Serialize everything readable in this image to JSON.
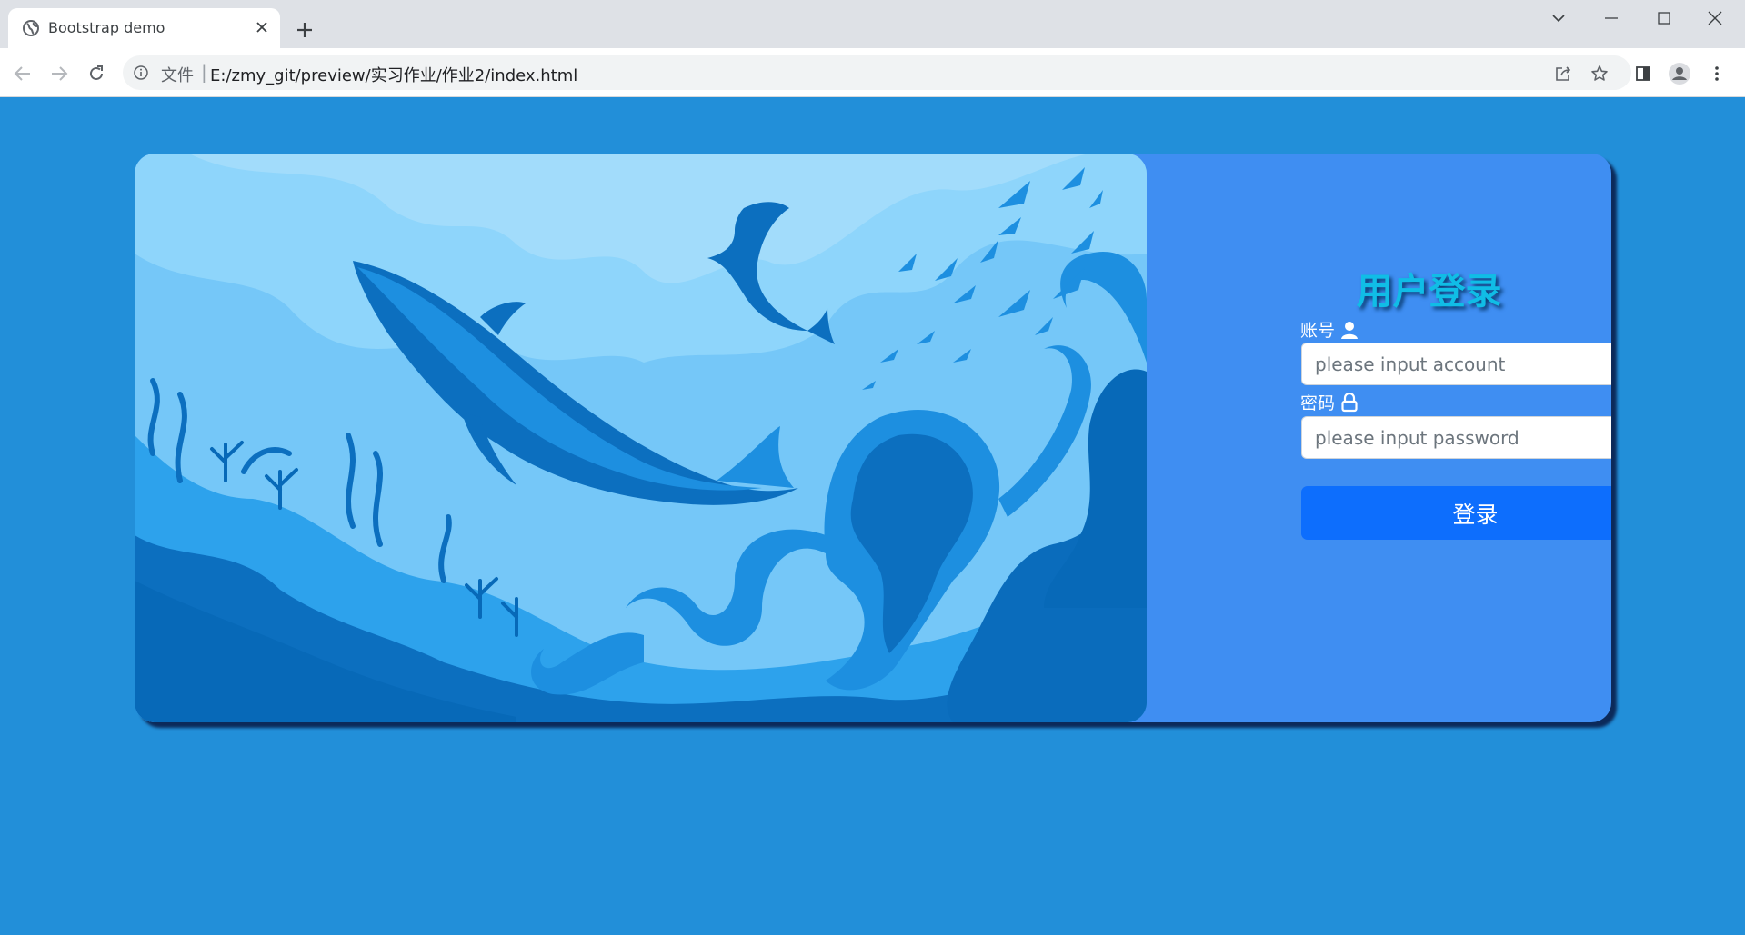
{
  "browser": {
    "tab_title": "Bootstrap demo",
    "url_scheme_label": "文件",
    "url_separator": "|",
    "url": "E:/zmy_git/preview/实习作业/作业2/index.html"
  },
  "colors": {
    "page_background": "#228fd9",
    "card_background": "#3f8ef2",
    "title_color": "#10bde6",
    "button_color": "#0d6efd"
  },
  "login": {
    "title": "用户登录",
    "account_label": "账号",
    "account_placeholder": "please input account",
    "password_label": "密码",
    "password_placeholder": "please input password",
    "submit_label": "登录"
  }
}
